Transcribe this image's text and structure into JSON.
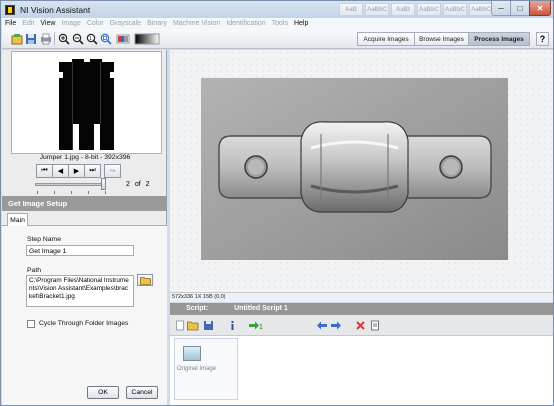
{
  "window": {
    "title": "NI Vision Assistant",
    "controls": {
      "minimize": "─",
      "maximize": "□",
      "close": "✕"
    },
    "ribbon_ghost": [
      "AaB",
      "AaBbC",
      "AaBt",
      "AaBbC",
      "AaBbC",
      "AaBbC",
      "AaBbC"
    ]
  },
  "menu": {
    "items": [
      {
        "label": "File",
        "enabled": true
      },
      {
        "label": "Edit",
        "enabled": false
      },
      {
        "label": "View",
        "enabled": true
      },
      {
        "label": "Image",
        "enabled": false
      },
      {
        "label": "Color",
        "enabled": false
      },
      {
        "label": "Grayscale",
        "enabled": false
      },
      {
        "label": "Binary",
        "enabled": false
      },
      {
        "label": "Machine Vision",
        "enabled": false
      },
      {
        "label": "Identification",
        "enabled": false
      },
      {
        "label": "Tools",
        "enabled": false
      },
      {
        "label": "Help",
        "enabled": true
      }
    ]
  },
  "toolbar": {
    "icons": [
      "acquire-icon",
      "save-icon",
      "print-icon",
      "zoom-in-icon",
      "zoom-out-icon",
      "zoom-fit-icon",
      "zoom-1to1-icon",
      "palette-icon",
      "gradient-icon"
    ],
    "modes": {
      "acquire": "Acquire Images",
      "browse": "Browse Images",
      "process": "Process Images"
    },
    "active_mode": "Process Images",
    "help": "?"
  },
  "browser": {
    "caption": "Jumper 1.jpg - 8-bit - 392x396",
    "nav": [
      "⏮",
      "◀",
      "▶",
      "⏭",
      "↪"
    ],
    "page": {
      "current": "2",
      "of": "of",
      "total": "2"
    },
    "slider_position": 1.0
  },
  "setup": {
    "header": "Get Image Setup",
    "tab": "Main",
    "step_name_label": "Step Name",
    "step_name_value": "Get Image 1",
    "path_label": "Path",
    "path_value": "C:\\Program Files\\National Instruments\\Vision Assistant\\Examples\\bracket\\Bracket1.jpg",
    "cycle_label": "Cycle Through Folder Images",
    "cycle_checked": false,
    "ok": "OK",
    "cancel": "Cancel"
  },
  "image_view": {
    "status": "572x336 1X 15B    (0,0)"
  },
  "script": {
    "label": "Script:",
    "name": "Untitled Script 1",
    "tools": [
      "new-script-icon",
      "open-script-icon",
      "save-script-icon",
      "info-icon",
      "run-once-icon",
      "move-left-icon",
      "move-right-icon",
      "delete-step-icon",
      "properties-icon"
    ],
    "steps": [
      {
        "label": "Original Image"
      }
    ]
  },
  "colors": {
    "panel_header": "#9a9a9a",
    "script_header": "#969696",
    "accent_blue": "#2f6bc4",
    "close_red": "#c9543c"
  }
}
